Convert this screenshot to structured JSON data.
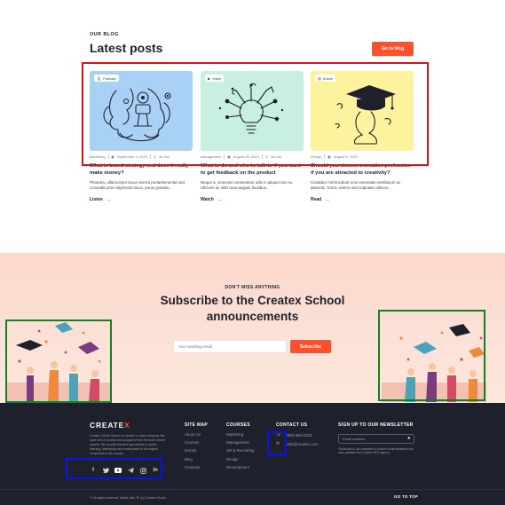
{
  "blog": {
    "eyebrow": "OUR BLOG",
    "title": "Latest posts",
    "goto_label": "Go to blog",
    "posts": [
      {
        "tag": "Podcast",
        "tag_icon": "microphone-icon",
        "category": "Marketing",
        "date": "September 4, 2020",
        "duration": "36 min",
        "title": "What is brand strategy and does it really make money?",
        "excerpt": "Pharetra, ullamcorper lacus viverra portaelementid sed. Convallis proin dignissim lacus, purus gravida...",
        "cta": "Listen",
        "bg": "#a9d1f5"
      },
      {
        "tag": "Video",
        "tag_icon": "play-icon",
        "category": "Management",
        "date": "August 25, 2020",
        "duration": "45 min",
        "title": "What to do and who to talk to if you want to get feedback on the product",
        "excerpt": "Neque a, senectus consectetur odio in aliquet nec eu. Ultricies ac nibh urna aegiuts faucibus...",
        "cta": "Watch",
        "bg": "#c8efe0"
      },
      {
        "tag": "Article",
        "tag_icon": "file-icon",
        "category": "Design",
        "date": "August 8, 2020",
        "duration": "",
        "title": "Should you choose a creative profession if you are attracted to creativity?",
        "excerpt": "Curabitur nisl tincidunt eros venenatis vestibulum ac placerat. Tortor, viverra sed vulputate ultrices...",
        "cta": "Read",
        "bg": "#fdf39f"
      }
    ]
  },
  "subscribe": {
    "eyebrow": "DON'T MISS ANYTHING",
    "title": "Subscribe to the Createx School announcements",
    "placeholder": "Your working email",
    "button": "Subscribe"
  },
  "footer": {
    "logo_main": "CREATE",
    "logo_x": "X",
    "about": "Createx Online School is a leader in online studying. We have lots of courses and programs from the main market experts. We provide relevant approaches to online learning, internships and employment in the largest companies in the country.",
    "socials": [
      "facebook-icon",
      "twitter-icon",
      "youtube-icon",
      "telegram-icon",
      "instagram-icon",
      "linkedin-icon"
    ],
    "sitemap": {
      "heading": "SITE MAP",
      "items": [
        "About Us",
        "Courses",
        "Events",
        "Blog",
        "Contacts"
      ]
    },
    "courses": {
      "heading": "COURSES",
      "items": [
        "Marketing",
        "Management",
        "HR & Recruiting",
        "Design",
        "Development"
      ]
    },
    "contact": {
      "heading": "CONTACT US",
      "phone": "(405) 555-0128",
      "email": "hello@createx.com"
    },
    "newsletter": {
      "heading": "SIGN UP TO OUR NEWSLETTER",
      "placeholder": "Email address",
      "note": "*Subscribe to our newsletter to receive communications and early updates from Createx SEO Agency."
    },
    "copyright": "© All rights reserved. Made with",
    "copyright_by": "by Createx Studio",
    "go_to_top": "GO TO TOP"
  },
  "colors": {
    "accent": "#ff4f2b",
    "dark": "#1e212c",
    "annotation_red": "#d8141a",
    "annotation_green": "#11821f",
    "annotation_blue": "#0a14e6"
  }
}
